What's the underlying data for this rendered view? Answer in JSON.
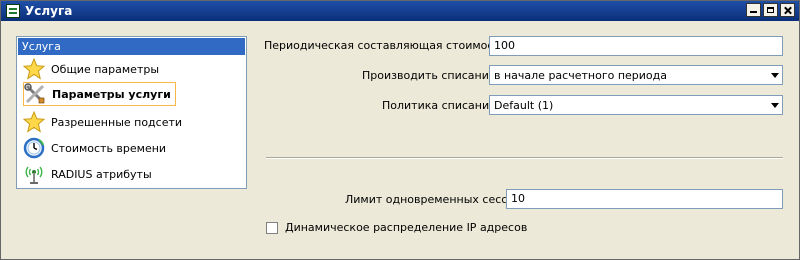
{
  "window": {
    "title": "Услуга"
  },
  "nav": {
    "header": "Услуга",
    "items": [
      {
        "label": "Общие параметры",
        "icon": "star-icon",
        "active": false
      },
      {
        "label": "Параметры услуги",
        "icon": "tools-icon",
        "active": true
      },
      {
        "label": "Разрешенные подсети",
        "icon": "star-icon",
        "active": false
      },
      {
        "label": "Стоимость времени",
        "icon": "clock-icon",
        "active": false
      },
      {
        "label": "RADIUS атрибуты",
        "icon": "antenna-icon",
        "active": false
      }
    ]
  },
  "form": {
    "periodic_cost_label": "Периодическая составляющая стоимости",
    "periodic_cost_value": "100",
    "charge_label": "Производить списание",
    "charge_value": "в начале расчетного периода",
    "policy_label": "Политика списания",
    "policy_value": "Default (1)",
    "session_limit_label": "Лимит одновременных сессий",
    "session_limit_value": "10",
    "dynamic_ip_label": "Динамическое распределение IP адресов",
    "dynamic_ip_checked": false
  }
}
